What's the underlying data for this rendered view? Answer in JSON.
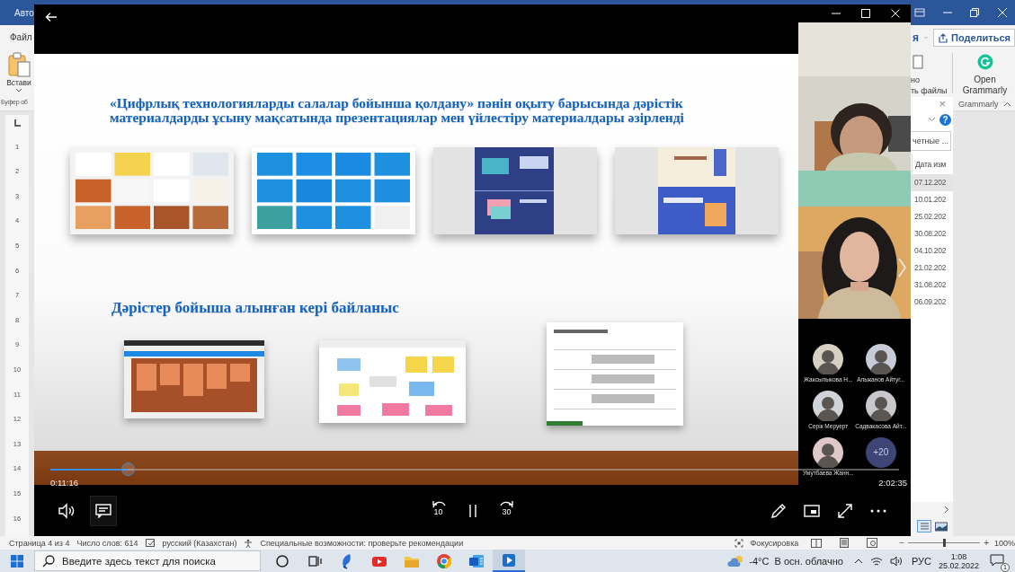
{
  "word": {
    "title": "Авто",
    "menu_item": "Файл",
    "account": "я",
    "share": "Поделиться",
    "paste_label": "Встави",
    "ribbon_fragment": [
      "но",
      "ть файлы"
    ],
    "grammarly_button": "Open Grammarly",
    "groups": [
      "Буфер об",
      "Grammarly"
    ],
    "ruler": [
      "1",
      "2",
      "3",
      "4",
      "5",
      "6",
      "7",
      "8",
      "9",
      "10",
      "11",
      "12",
      "13",
      "14",
      "15",
      "16"
    ],
    "pane": {
      "close": "×",
      "help": "?",
      "search": "четные ...",
      "column": "Дата изм",
      "rows": [
        {
          "date": "07.12.202",
          "selected": true
        },
        {
          "date": "10.01.202",
          "selected": false
        },
        {
          "date": "25.02.202",
          "selected": false
        },
        {
          "date": "30.08.202",
          "selected": false
        },
        {
          "date": "04.10.202",
          "selected": false
        },
        {
          "date": "21.02.202",
          "selected": false
        },
        {
          "date": "31.08.202",
          "selected": false
        },
        {
          "date": "06.09.202",
          "selected": false
        }
      ]
    }
  },
  "player": {
    "slide": {
      "title": [
        "«Цифрлық технологияларды салалар бойынша қолдану» пәнін оқыту барысында дәрістік",
        "материалдарды ұсыну мақсатында презентациялар мен үйлестіру материалдары әзірленді"
      ],
      "heading": "Дәрістер бойыша алынған кері байланыс"
    },
    "seek": {
      "level": 0.092,
      "elapsed": "0:11:16",
      "total": "2:02:35"
    },
    "participants": [
      {
        "name": "Жаксылыкова Н..."
      },
      {
        "name": "Альжанов Айтуг..."
      },
      {
        "name": "Серік Меруерт"
      },
      {
        "name": "Садвакасова Айт..."
      },
      {
        "name": "Умутбаева Жанн..."
      }
    ],
    "more_participants": "+20",
    "rewind": "10",
    "forward": "30"
  },
  "status_bar": {
    "page": "Страница 4 из 4",
    "words": "Число слов: 614",
    "language": "русский (Казахстан)",
    "accessibility": "Специальные возможности: проверьте рекомендации",
    "focus": "Фокусировка",
    "zoom": {
      "out": "−",
      "in": "+",
      "level": 0.5,
      "value": "100%"
    }
  },
  "taskbar": {
    "search_placeholder": "Введите здесь текст для поиска",
    "apps": [
      {
        "selected": false
      },
      {
        "selected": false
      },
      {
        "selected": false
      },
      {
        "selected": false
      },
      {
        "selected": false
      },
      {
        "selected": false
      },
      {
        "selected": false
      },
      {
        "selected": true
      }
    ],
    "weather": "-4°C  В осн. облачно",
    "language": "РУС",
    "time": "1:08",
    "date": "25.02.2022",
    "notifications": "1"
  }
}
